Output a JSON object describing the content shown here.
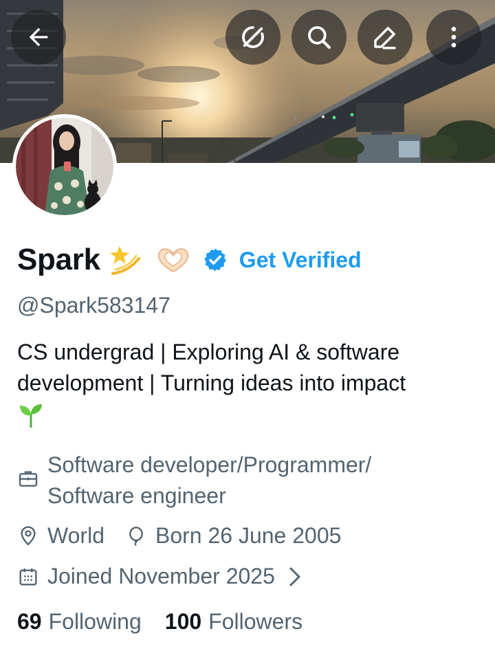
{
  "header": {
    "back_icon": "arrow-left-icon",
    "actions": [
      {
        "icon": "grok-icon"
      },
      {
        "icon": "search-icon"
      },
      {
        "icon": "edit-icon"
      },
      {
        "icon": "more-vertical-icon"
      }
    ]
  },
  "profile": {
    "display_name": "Spark",
    "name_emojis": [
      "dizzy-emoji",
      "heart-hands-emoji"
    ],
    "verified_badge_icon": "verified-badge-icon",
    "get_verified_label": "Get Verified",
    "handle": "@Spark583147",
    "bio_line1": "CS undergrad | Exploring AI & software",
    "bio_line2": "development | Turning ideas into impact",
    "bio_emoji": "seedling-emoji"
  },
  "meta": {
    "profession_line1": "Software developer/Programmer/",
    "profession_line2": "Software engineer",
    "location": "World",
    "birthday": "Born 26 June 2005",
    "joined": "Joined November 2025"
  },
  "stats": {
    "following_count": "69",
    "following_label": "Following",
    "followers_count": "100",
    "followers_label": "Followers"
  },
  "colors": {
    "accent": "#1d9bf0",
    "secondary_text": "#536471",
    "primary_text": "#0f1419"
  }
}
